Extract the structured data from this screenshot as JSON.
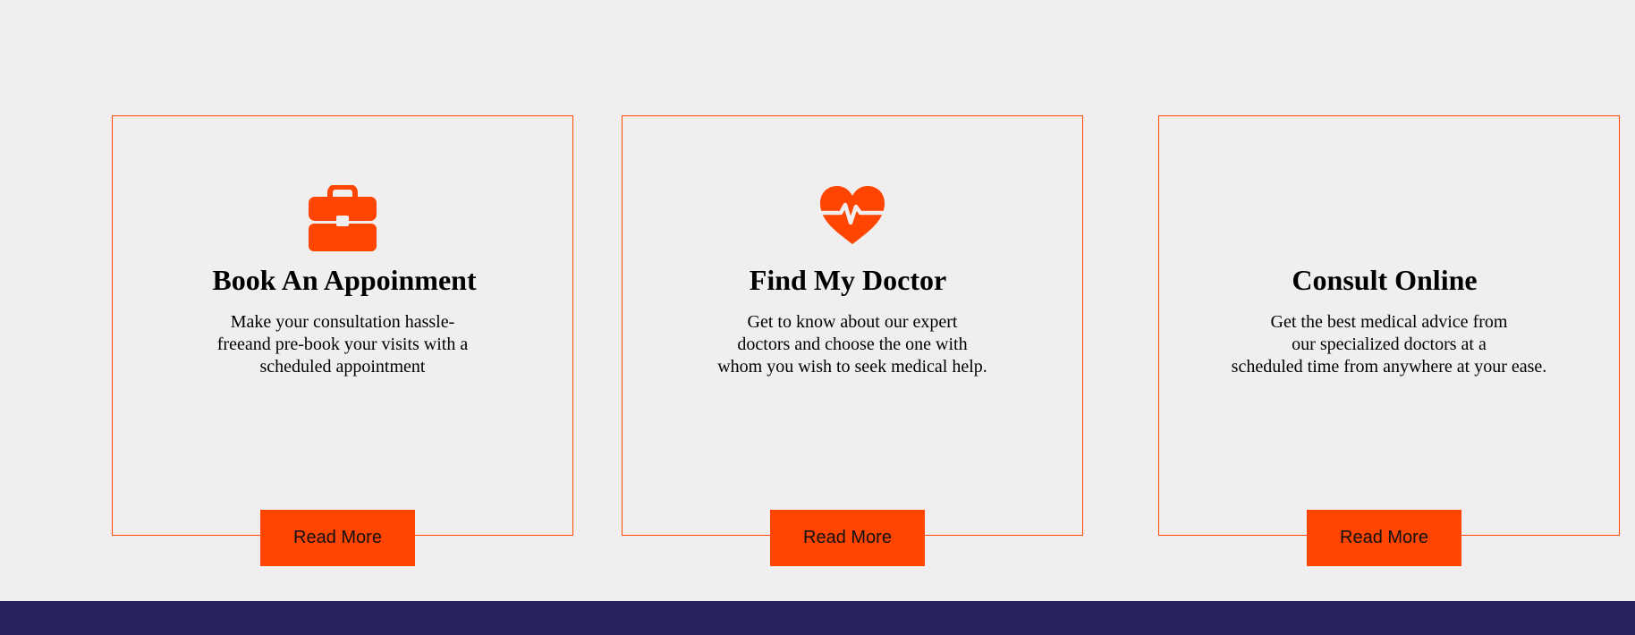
{
  "colors": {
    "accent": "#ff4500",
    "background": "#f0eeef",
    "footer": "#28235e",
    "text": "#000000"
  },
  "cards": [
    {
      "icon": "briefcase-icon",
      "title": "Book An Appoinment",
      "text_lines": [
        "Make your consultation hassle-",
        "freeand pre-book your visits with a",
        "scheduled appointment"
      ],
      "button_label": "Read More"
    },
    {
      "icon": "heartbeat-icon",
      "title": "Find My Doctor",
      "text_lines": [
        "Get to know about our expert",
        "doctors and choose the one with",
        "whom you wish to seek medical help."
      ],
      "button_label": "Read More"
    },
    {
      "icon": "",
      "title": "Consult Online",
      "text_lines": [
        "Get the best medical advice from",
        "our specialized doctors at a",
        "scheduled time from anywhere at your ease."
      ],
      "button_label": "Read More"
    }
  ]
}
